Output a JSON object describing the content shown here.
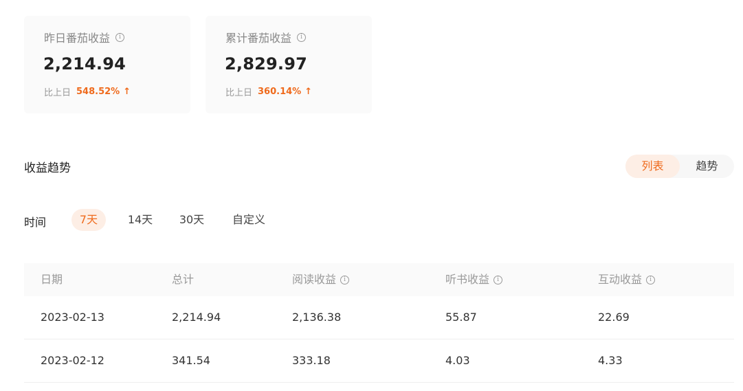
{
  "cards": [
    {
      "title": "昨日番茄收益",
      "value": "2,214.94",
      "compare_label": "比上日",
      "compare_pct": "548.52%",
      "trend_icon": "arrow-up-icon"
    },
    {
      "title": "累计番茄收益",
      "value": "2,829.97",
      "compare_label": "比上日",
      "compare_pct": "360.14%",
      "trend_icon": "arrow-up-icon"
    }
  ],
  "info_symbol": "i",
  "up_symbol": "↑",
  "section": {
    "title": "收益趋势"
  },
  "view_toggle": {
    "options": [
      "列表",
      "趋势"
    ],
    "selected": "列表"
  },
  "time_filter": {
    "label": "时间",
    "options": [
      "7天",
      "14天",
      "30天",
      "自定义"
    ],
    "selected": "7天"
  },
  "table": {
    "columns": [
      "日期",
      "总计",
      "阅读收益",
      "听书收益",
      "互动收益"
    ],
    "rows": [
      [
        "2023-02-13",
        "2,214.94",
        "2,136.38",
        "55.87",
        "22.69"
      ],
      [
        "2023-02-12",
        "341.54",
        "333.18",
        "4.03",
        "4.33"
      ]
    ]
  },
  "colors": {
    "accent": "#ef6a1c",
    "accent_bg": "#fdeee5",
    "card_bg": "#fafafa"
  }
}
